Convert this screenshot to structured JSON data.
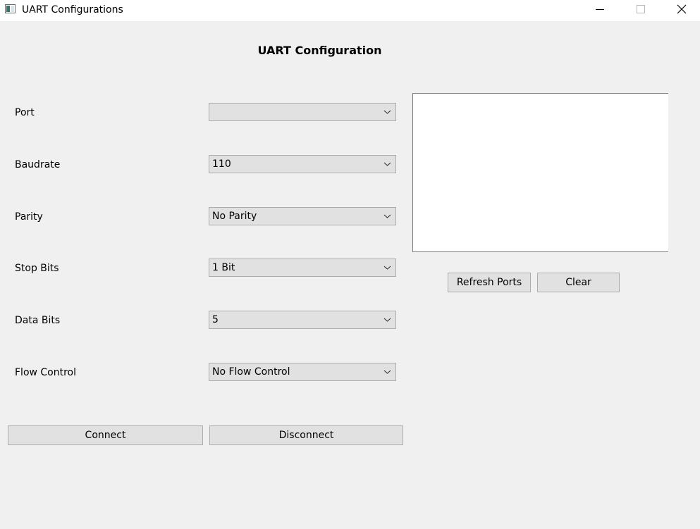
{
  "window": {
    "title": "UART Configurations"
  },
  "heading": "UART Configuration",
  "fields": [
    {
      "label": "Port",
      "value": ""
    },
    {
      "label": "Baudrate",
      "value": "110"
    },
    {
      "label": "Parity",
      "value": "No Parity"
    },
    {
      "label": "Stop Bits",
      "value": "1 Bit"
    },
    {
      "label": "Data Bits",
      "value": "5"
    },
    {
      "label": "Flow Control",
      "value": "No Flow Control"
    }
  ],
  "log": {
    "content": ""
  },
  "buttons": {
    "refresh_ports": "Refresh Ports",
    "clear": "Clear",
    "connect": "Connect",
    "disconnect": "Disconnect"
  },
  "icons": {
    "app": "app-window-icon",
    "minimize": "minimize-icon",
    "maximize": "maximize-icon",
    "close": "close-icon",
    "dropdown": "chevron-down-icon"
  }
}
